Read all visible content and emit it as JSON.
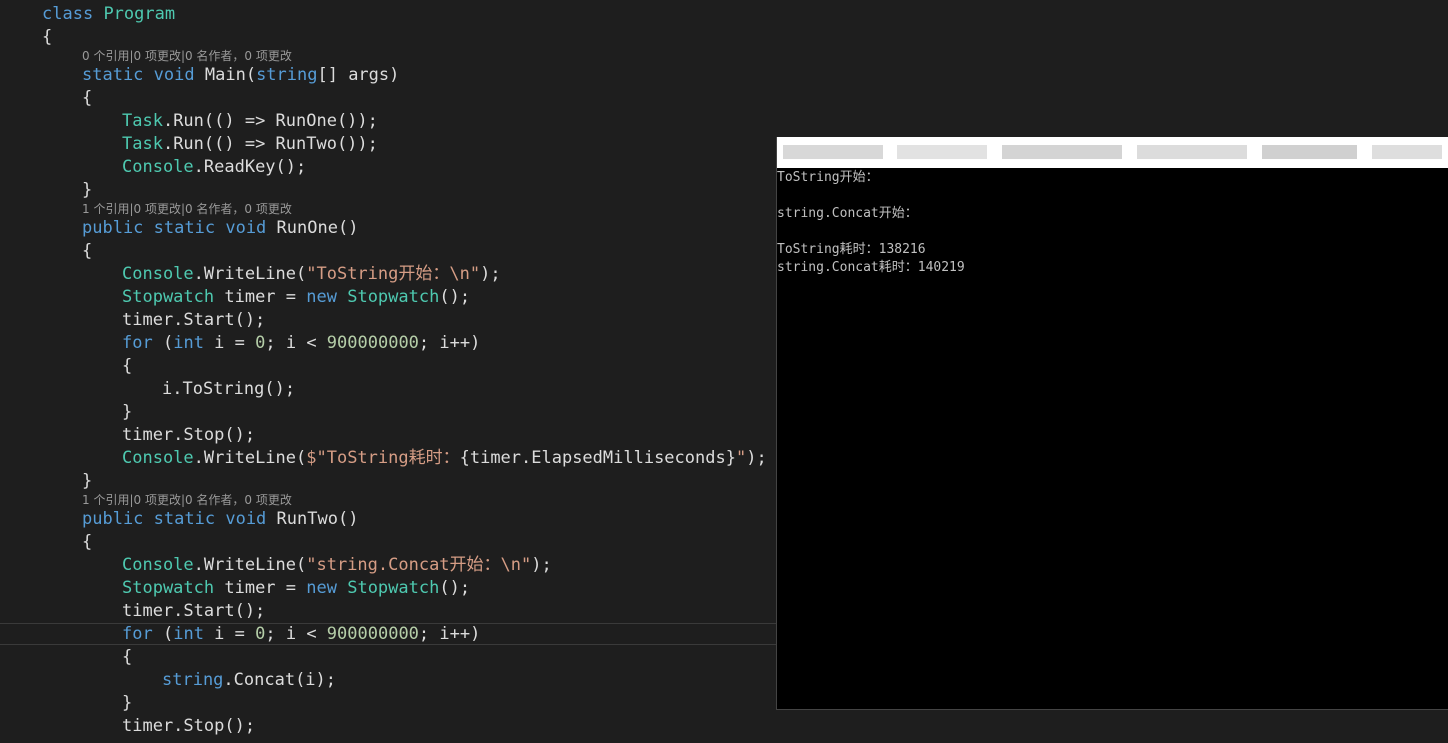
{
  "editor": {
    "class_keyword": "class",
    "class_name": "Program",
    "lens_main": "0 个引用|0 项更改|0 名作者，0 项更改",
    "lens_runone": "1 个引用|0 项更改|0 名作者，0 项更改",
    "lens_runtwo": "1 个引用|0 项更改|0 名作者，0 项更改",
    "kw_static": "static",
    "kw_void": "void",
    "kw_public": "public",
    "kw_string": "string",
    "kw_new": "new",
    "kw_for": "for",
    "kw_int": "int",
    "main_name": "Main(",
    "main_args": "[] args)",
    "task": "Task",
    "run_one_call": ".Run(() => RunOne());",
    "run_two_call": ".Run(() => RunTwo());",
    "console": "Console",
    "readkey": ".ReadKey();",
    "runone_name": "RunOne()",
    "runtwo_name": "RunTwo()",
    "writeline_open": ".WriteLine(",
    "writeline_close": ");",
    "str_tostring_start": "\"ToString开始：\\n\"",
    "str_concat_start": "\"string.Concat开始：\\n\"",
    "stopwatch": "Stopwatch",
    "timer_eq": " timer = ",
    "ctor_end": "();",
    "timer_start": "timer.Start();",
    "loop_head": " i = ",
    "zero": "0",
    "loop_mid": "; i < ",
    "loop_limit": "900000000",
    "loop_tail": "; i++)",
    "tostring_call": "i.ToString();",
    "concat_call": ".Concat(i);",
    "timer_stop": "timer.Stop();",
    "interp_prefix": "$\"ToString耗时：",
    "interp_expr": "{timer.ElapsedMilliseconds}",
    "interp_suffix": "\"",
    "open_brace": "{",
    "close_brace": "}",
    "open_paren": "(",
    "space": " "
  },
  "console_window": {
    "output": [
      "ToString开始：",
      "",
      "string.Concat开始：",
      "",
      "ToString耗时：138216",
      "string.Concat耗时：140219"
    ]
  }
}
